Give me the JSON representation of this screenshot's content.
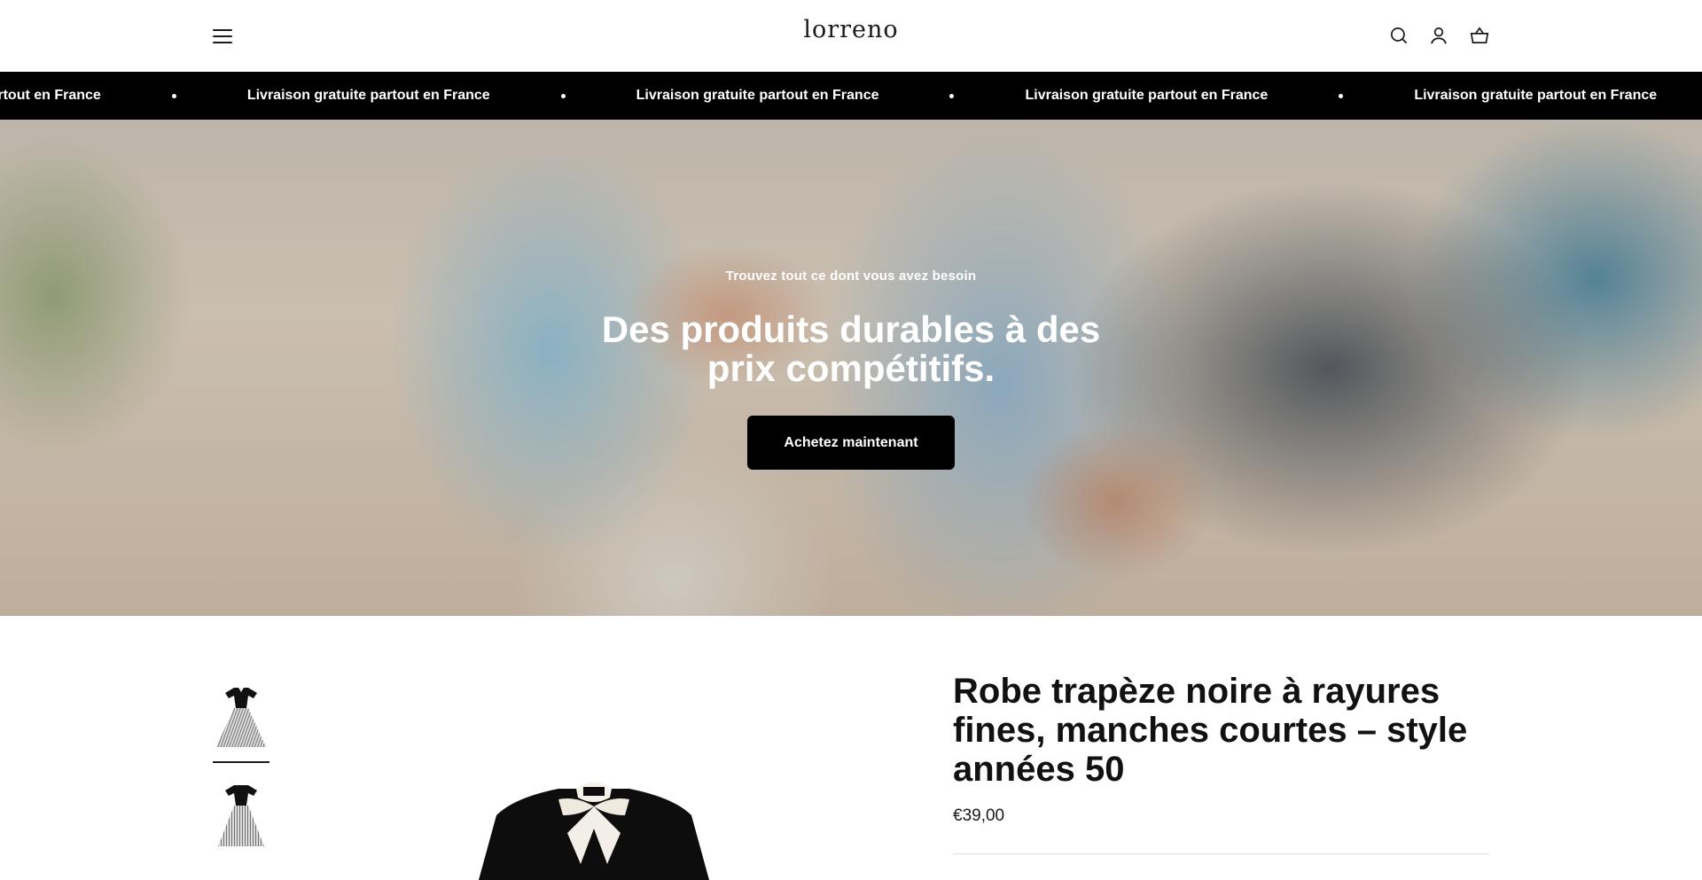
{
  "header": {
    "logo": "lorreno",
    "icons": [
      "menu-icon",
      "search-icon",
      "account-icon",
      "cart-icon"
    ]
  },
  "announcement": {
    "items": [
      "Livraison gratuite partout en France",
      "Livraison gratuite partout en France",
      "Livraison gratuite partout en France",
      "Livraison gratuite partout en France",
      "Livraison gratuite partout en France"
    ]
  },
  "hero": {
    "subtitle": "Trouvez tout ce dont vous avez besoin",
    "title": "Des produits durables à des prix compétitifs.",
    "button": "Achetez maintenant"
  },
  "product": {
    "title": "Robe trapèze noire à rayures fines, manches courtes – style années 50",
    "price": "€39,00",
    "thumbnails_count": 2
  },
  "colors": {
    "announcement_bg": "#000000",
    "button_bg": "#000000",
    "text": "#1a1a1a"
  }
}
